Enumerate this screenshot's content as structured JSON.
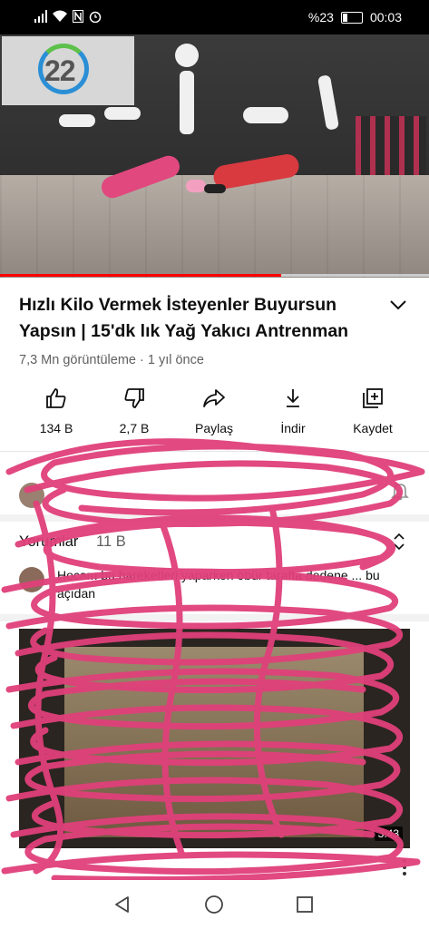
{
  "status_bar": {
    "battery_text": "%23",
    "time": "00:03",
    "icons": [
      "signal-icon",
      "wifi-icon",
      "nfc-icon",
      "alarm-icon",
      "battery-icon"
    ]
  },
  "video": {
    "logo_number": "22",
    "progress_fraction": 0.655
  },
  "title": "Hızlı Kilo Vermek İsteyenler Buyursun Yapsın | 15'dk lık Yağ Yakıcı Antrenman",
  "meta": "7,3 Mn görüntüleme · 1 yıl önce",
  "actions": [
    {
      "icon": "like-icon",
      "label": "134 B"
    },
    {
      "icon": "dislike-icon",
      "label": "2,7 B"
    },
    {
      "icon": "share-icon",
      "label": "Paylaş"
    },
    {
      "icon": "download-icon",
      "label": "İndir"
    },
    {
      "icon": "save-icon",
      "label": "Kaydet"
    }
  ],
  "comments": {
    "label": "Yorumlar",
    "count": "11 B",
    "top_comment": "Hocam bu hareketleri yaparken öbür tarafta dedene ... bu açıdan"
  },
  "up_next": {
    "duration": "3:43"
  },
  "colors": {
    "accent": "#ff0000",
    "scribble": "#e0407a"
  }
}
